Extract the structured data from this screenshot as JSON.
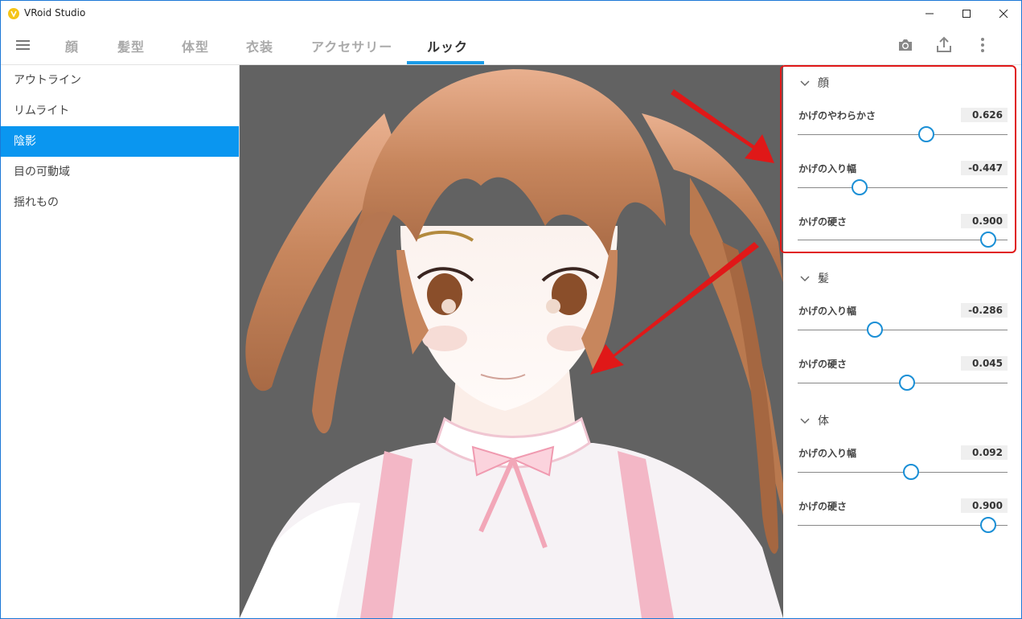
{
  "window": {
    "title": "VRoid Studio"
  },
  "tabs": [
    "顔",
    "髪型",
    "体型",
    "衣装",
    "アクセサリー",
    "ルック"
  ],
  "active_tab": "ルック",
  "sidebar": {
    "items": [
      {
        "label": "アウトライン"
      },
      {
        "label": "リムライト"
      },
      {
        "label": "陰影"
      },
      {
        "label": "目の可動域"
      },
      {
        "label": "揺れもの"
      }
    ],
    "active": "陰影"
  },
  "panel": {
    "sections": [
      {
        "title": "顔",
        "sliders": [
          {
            "label": "かげのやわらかさ",
            "value": "0.626"
          },
          {
            "label": "かげの入り幅",
            "value": "-0.447"
          },
          {
            "label": "かげの硬さ",
            "value": "0.900"
          }
        ]
      },
      {
        "title": "髪",
        "sliders": [
          {
            "label": "かげの入り幅",
            "value": "-0.286"
          },
          {
            "label": "かげの硬さ",
            "value": "0.045"
          }
        ]
      },
      {
        "title": "体",
        "sliders": [
          {
            "label": "かげの入り幅",
            "value": "0.092"
          },
          {
            "label": "かげの硬さ",
            "value": "0.900"
          }
        ]
      }
    ]
  },
  "colors": {
    "accent": "#0a96f0",
    "highlight": "#e01818",
    "viewport_bg": "#626262"
  }
}
